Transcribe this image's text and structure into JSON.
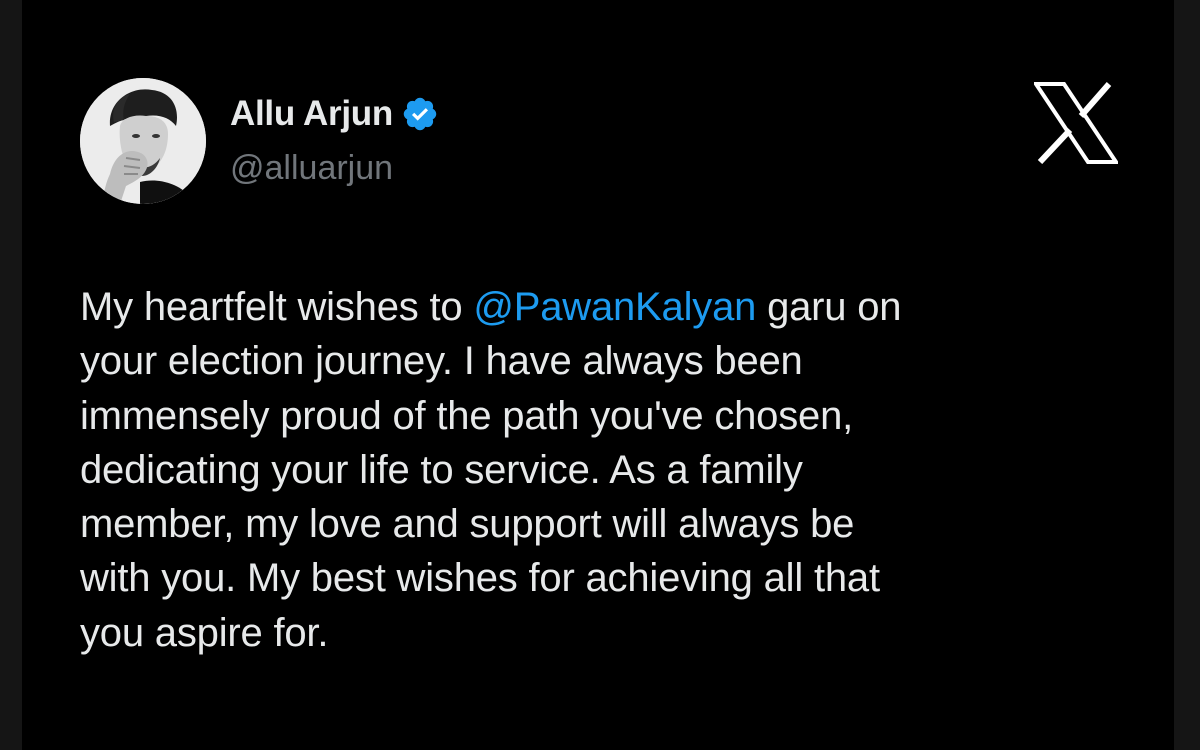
{
  "author": {
    "display_name": "Allu Arjun",
    "handle": "@alluarjun",
    "verified": true,
    "verified_icon": "verified-badge-icon",
    "verified_color": "#1d9bf0"
  },
  "brand": {
    "logo": "x-logo-icon"
  },
  "tweet": {
    "line1_before": "My heartfelt wishes to ",
    "mention": "@PawanKalyan",
    "line1_after": " garu on",
    "line2": "your election journey. I have always been",
    "line3": "immensely proud of the path you've chosen,",
    "line4": "dedicating your life to service. As a family",
    "line5": "member, my love and support will always be",
    "line6": "with you. My best wishes for achieving all that",
    "line7": "you aspire for."
  },
  "colors": {
    "background": "#000000",
    "text": "#e7e9ea",
    "secondary_text": "#71767b",
    "mention": "#1d9bf0"
  }
}
